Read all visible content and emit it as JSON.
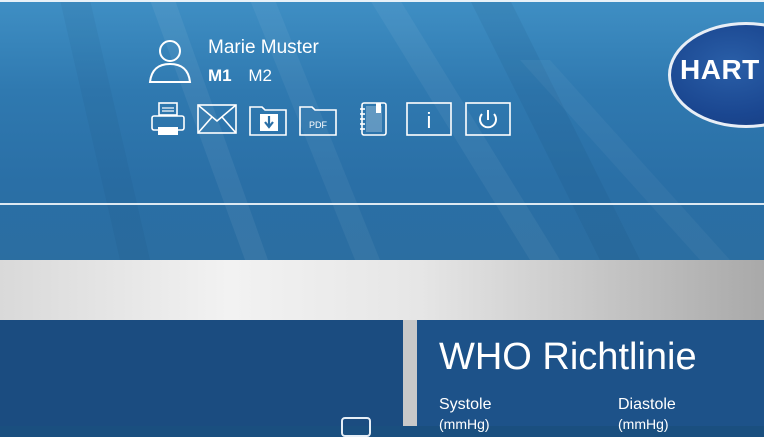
{
  "user": {
    "name": "Marie Muster",
    "icon": "user-icon"
  },
  "modes": [
    {
      "label": "M1",
      "active": true
    },
    {
      "label": "M2",
      "active": false
    }
  ],
  "toolbar": [
    {
      "name": "print",
      "icon": "printer-icon"
    },
    {
      "name": "email",
      "icon": "envelope-icon"
    },
    {
      "name": "download",
      "icon": "download-icon"
    },
    {
      "name": "pdf",
      "icon": "pdf-icon",
      "label": "PDF"
    },
    {
      "name": "notebook",
      "icon": "notebook-icon"
    },
    {
      "name": "info",
      "icon": "info-icon",
      "label": "i"
    },
    {
      "name": "power",
      "icon": "power-icon"
    }
  ],
  "logo": {
    "text": "HART"
  },
  "who": {
    "title": "WHO Richtlinie",
    "columns": [
      {
        "label": "Systole",
        "sub": "(mmHg)"
      },
      {
        "label": "Diastole",
        "sub": "(mmHg)"
      }
    ]
  },
  "colors": {
    "header_top": "#3f8fc4",
    "header_bottom": "#2b6ea1",
    "panel_left": "#1b4c80",
    "panel_right": "#1d5289",
    "logo": "#1a4690"
  }
}
